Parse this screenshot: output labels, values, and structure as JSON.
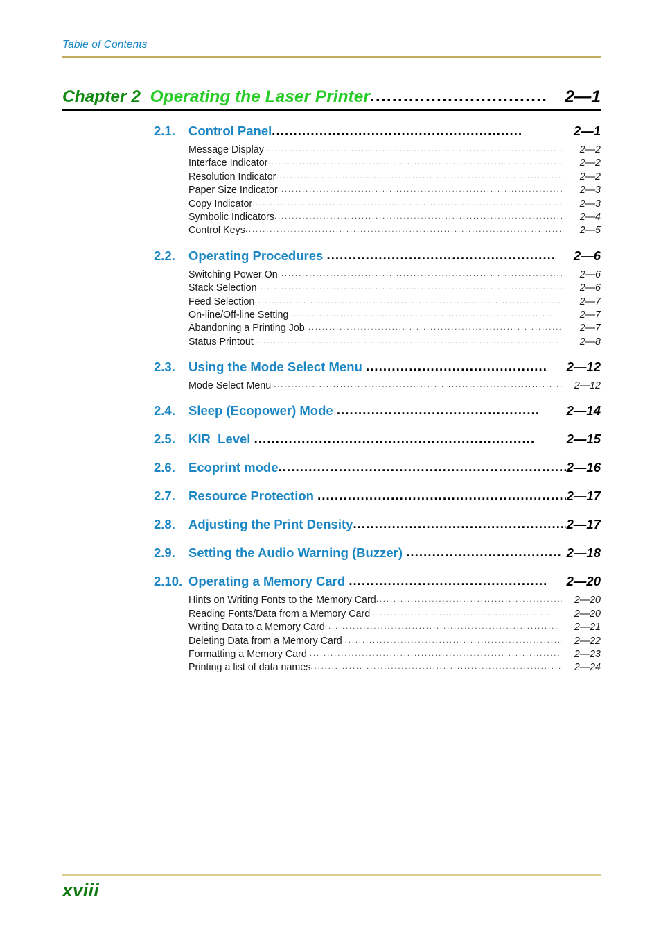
{
  "page": {
    "running_head": "Table of Contents",
    "folio": "xviii",
    "colors": {
      "accent_blue": "#1b86c4",
      "chapter_green_dark": "#108a10",
      "chapter_green_bright": "#27cc27",
      "rule_gold": "#c4ac5e",
      "rule_gold_footer": "#ddcb8e",
      "rule_black": "#000000",
      "folio_green": "#0f7a12",
      "body_text": "#1a1a1a"
    }
  },
  "chapter": {
    "number": "Chapter 2",
    "title": "Operating the Laser Printer",
    "page": "2—1",
    "leader": "................................"
  },
  "sections": [
    {
      "number": "2.1.",
      "title": "Control Panel",
      "page": "2—1",
      "leader": "..........................................................",
      "entries": [
        {
          "title": "Message Display",
          "page": "2—2",
          "leader": "..............................................................................................."
        },
        {
          "title": "Interface Indicator",
          "page": "2—2",
          "leader": "........................................................................................"
        },
        {
          "title": "Resolution Indicator",
          "page": "2—2",
          "leader": "..................................................................................."
        },
        {
          "title": "Paper Size Indicator",
          "page": "2—3",
          "leader": "...................................................................................."
        },
        {
          "title": "Copy Indicator",
          "page": "2—3",
          "leader": "................................................................................................."
        },
        {
          "title": "Symbolic Indicators",
          "page": "2—4",
          "leader": "...................................................................................."
        },
        {
          "title": "Control Keys",
          "page": "2—5",
          "leader": "..................................................................................................."
        }
      ]
    },
    {
      "number": "2.2.",
      "title": "Operating Procedures ",
      "page": "2—6",
      "leader": ".....................................................",
      "entries": [
        {
          "title": "Switching Power On",
          "page": "2—6",
          "leader": "......................................................................................."
        },
        {
          "title": "Stack Selection",
          "page": "2—6",
          "leader": "................................................................................................"
        },
        {
          "title": "Feed Selection",
          "page": "2—7",
          "leader": ".................................................................................................."
        },
        {
          "title": "On-line/Off-line Setting ",
          "page": "2—7",
          "leader": "............................................................................"
        },
        {
          "title": "Abandoning a Printing Job",
          "page": "2—7",
          "leader": "............................................................................"
        },
        {
          "title": "Status Printout ",
          "page": "2—8",
          "leader": ".............................................................................................."
        }
      ]
    },
    {
      "number": "2.3.",
      "title": "Using the Mode Select Menu ",
      "page": "2—12",
      "leader": "..........................................",
      "entries": [
        {
          "title": "Mode Select Menu ",
          "page": "2—12",
          "leader": ".........................................................................................."
        }
      ]
    },
    {
      "number": "2.4.",
      "title": "Sleep (Ecopower) Mode ",
      "page": "2—14",
      "leader": "...............................................",
      "entries": []
    },
    {
      "number": "2.5.",
      "title": "KIR  Level ",
      "page": "2—15",
      "leader": ".................................................................",
      "entries": []
    },
    {
      "number": "2.6.",
      "title": "Ecoprint mode",
      "page": "2—16",
      "leader": "........................................................................",
      "entries": []
    },
    {
      "number": "2.7.",
      "title": "Resource Protection ",
      "page": "2—17",
      "leader": ".................................................................",
      "entries": []
    },
    {
      "number": "2.8.",
      "title": "Adjusting the Print Density",
      "page": "2—17",
      "leader": "...................................................",
      "entries": []
    },
    {
      "number": "2.9.",
      "title": "Setting the Audio Warning (Buzzer) ",
      "page": "2—18",
      "leader": "....................................",
      "entries": []
    },
    {
      "number": "2.10.",
      "title": "Operating a Memory Card ",
      "page": "2—20",
      "leader": "..............................................",
      "entries": [
        {
          "title": "Hints on Writing Fonts to the Memory Card",
          "page": "2—20",
          "leader": "......................................................"
        },
        {
          "title": "Reading Fonts/Data from a Memory Card ",
          "page": "2—20",
          "leader": "..................................................."
        },
        {
          "title": "Writing Data to a Memory Card",
          "page": "2—21",
          "leader": "..................................................................."
        },
        {
          "title": "Deleting Data from a Memory Card ",
          "page": "2—22",
          "leader": "..............................................................."
        },
        {
          "title": "Formatting a Memory Card ",
          "page": "2—23",
          "leader": "........................................................................"
        },
        {
          "title": "Printing a list of data names",
          "page": "2—24",
          "leader": "..........................................................................."
        }
      ]
    }
  ]
}
